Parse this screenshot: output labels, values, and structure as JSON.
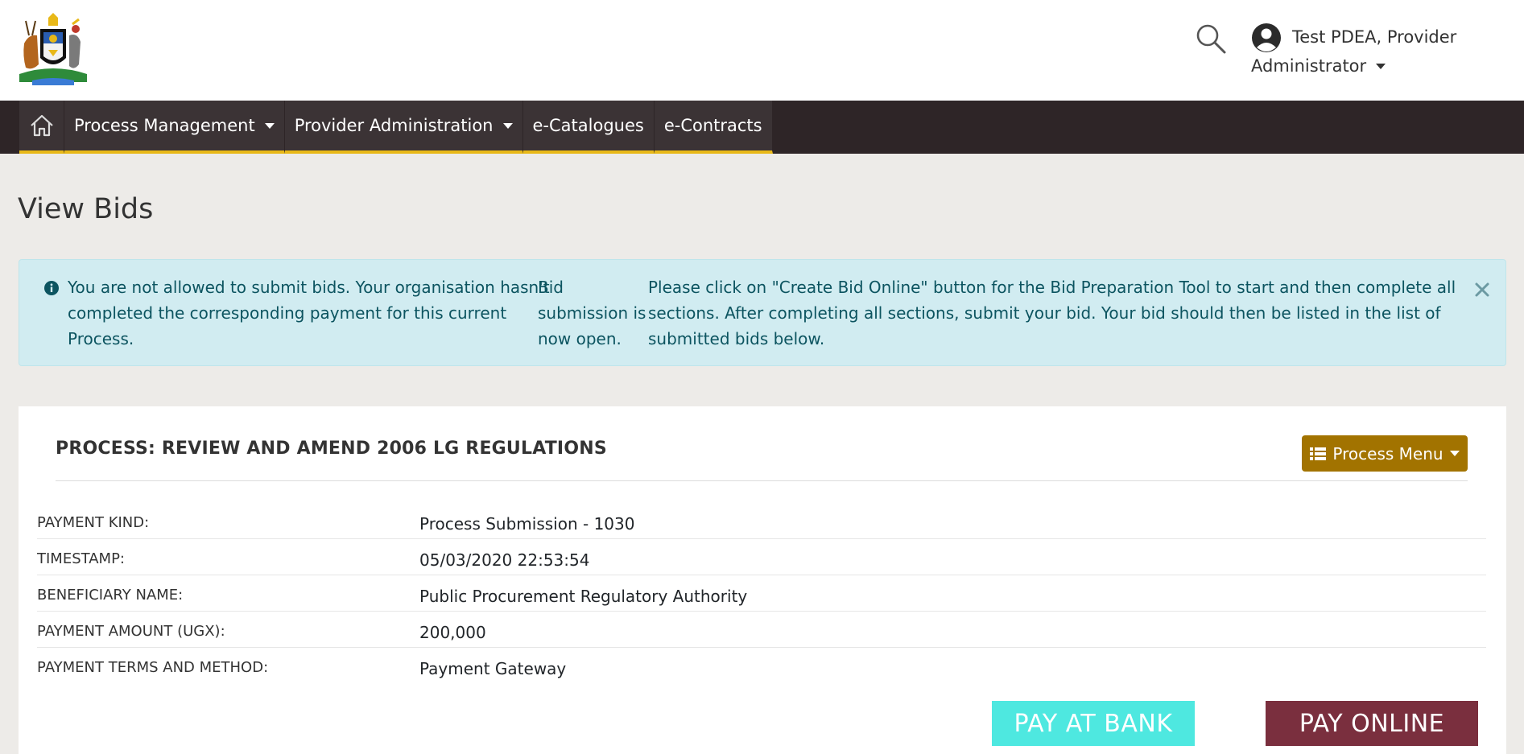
{
  "header": {
    "user": {
      "name_line1": "Test PDEA, Provider",
      "name_line2": "Administrator"
    }
  },
  "nav": {
    "items": [
      {
        "label": "Process Management"
      },
      {
        "label": "Provider Administration"
      },
      {
        "label": "e-Catalogues"
      },
      {
        "label": "e-Contracts"
      }
    ]
  },
  "page": {
    "title": "View Bids"
  },
  "alert": {
    "col1": "You are not allowed to submit bids. Your organisation hasn't completed the corresponding payment for this current Process.",
    "col2": "Bid submission is now open.",
    "col3": "Please click on \"Create Bid Online\" button for the Bid Preparation Tool to start and then complete all sections. After completing all sections, submit your bid. Your bid should then be listed in the list of submitted bids below."
  },
  "card": {
    "title": "PROCESS: REVIEW AND AMEND 2006 LG REGULATIONS",
    "process_menu_label": "Process Menu",
    "details": [
      {
        "label": "PAYMENT KIND:",
        "value": "Process Submission - 1030"
      },
      {
        "label": "TIMESTAMP:",
        "value": "05/03/2020 22:53:54"
      },
      {
        "label": "BENEFICIARY NAME:",
        "value": "Public Procurement Regulatory Authority"
      },
      {
        "label": "PAYMENT AMOUNT (UGX):",
        "value": "200,000"
      },
      {
        "label": "PAYMENT TERMS AND METHOD:",
        "value": "Payment Gateway"
      }
    ],
    "pay_bank_label": "PAY AT BANK",
    "pay_online_label": "PAY ONLINE"
  },
  "colors": {
    "navbar": "#2e2527",
    "nav_accent": "#e8b818",
    "process_menu": "#a27300",
    "pay_bank": "#4ee8e0",
    "pay_online": "#7a2f3e",
    "alert_bg": "#d1ecf1"
  }
}
